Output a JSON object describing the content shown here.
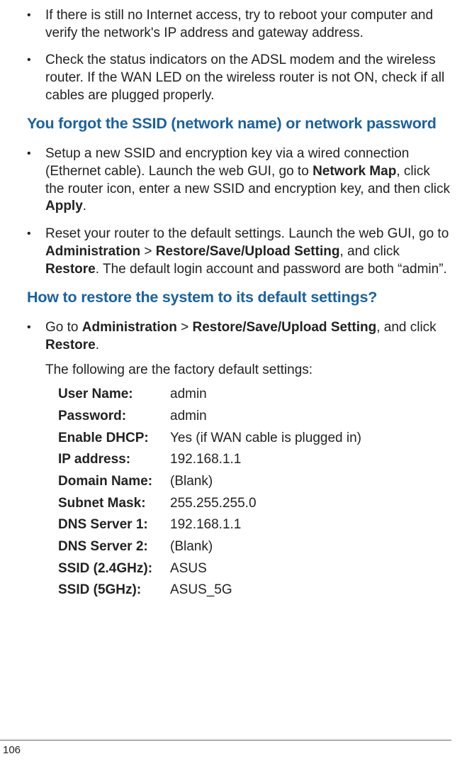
{
  "bullets_top": [
    "If there is still no Internet access, try to reboot your computer and verify the network's IP address and gateway address.",
    "Check the status indicators on the ADSL modem and the wireless router. If the WAN LED on the wireless router is not ON, check if all cables are plugged properly."
  ],
  "heading1": "You forgot the SSID (network name) or network password",
  "bullets_ssid": [
    {
      "pre": "Setup a new SSID and encryption key via a wired connection (Ethernet cable). Launch the web GUI, go to ",
      "b1": "Network Map",
      "mid1": ", click the router icon, enter a new SSID and encryption key, and then click ",
      "b2": "Apply",
      "post": "."
    },
    {
      "pre": "Reset your router to the default settings. Launch the web GUI, go to ",
      "b1": "Administration",
      "gt": " > ",
      "b2": "Restore/Save/Upload Setting",
      "mid": ", and click ",
      "b3": "Restore",
      "post": ". The default login account and password are both “admin”."
    }
  ],
  "heading2": "How to restore the system to its default settings?",
  "restore_bullet": {
    "pre": "Go to ",
    "b1": "Administration",
    "gt": " > ",
    "b2": "Restore/Save/Upload Setting",
    "mid": ", and click ",
    "b3": "Restore",
    "post": "."
  },
  "defaults_intro": "The following are the factory default settings:",
  "settings": [
    {
      "label": "User Name:",
      "value": "admin"
    },
    {
      "label": "Password:",
      "value": "admin"
    },
    {
      "label": "Enable DHCP:",
      "value": "Yes (if WAN cable is plugged in)"
    },
    {
      "label": "IP address:",
      "value": "192.168.1.1"
    },
    {
      "label": "Domain Name:",
      "value": "(Blank)"
    },
    {
      "label": "Subnet Mask:",
      "value": "255.255.255.0"
    },
    {
      "label": "DNS Server 1:",
      "value": "192.168.1.1"
    },
    {
      "label": "DNS Server 2:",
      "value": "(Blank)"
    },
    {
      "label": "SSID (2.4GHz):",
      "value": "ASUS"
    },
    {
      "label": "SSID (5GHz):",
      "value": "ASUS_5G"
    }
  ],
  "page_number": "106"
}
